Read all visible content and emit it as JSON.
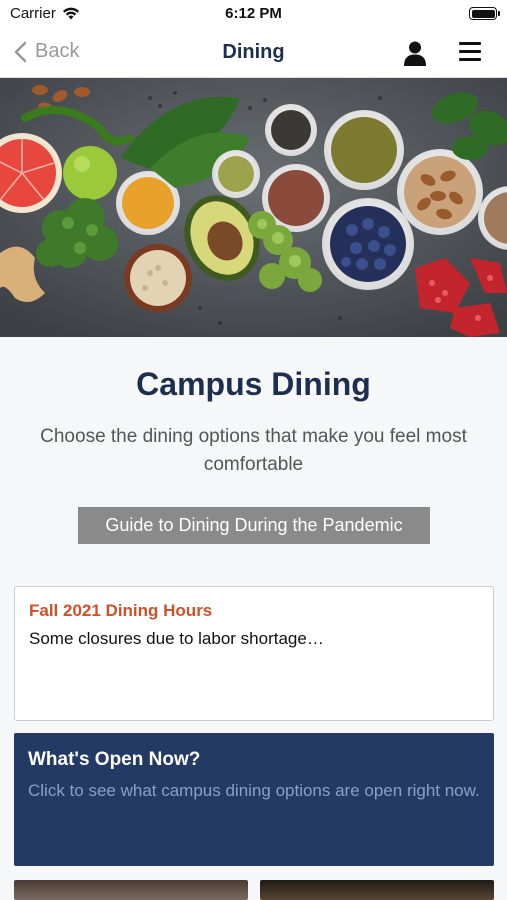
{
  "status_bar": {
    "carrier": "Carrier",
    "time": "6:12 PM"
  },
  "nav": {
    "back_label": "Back",
    "title": "Dining",
    "icons": [
      "chevron-left-icon",
      "user-icon",
      "menu-icon"
    ]
  },
  "hero": {
    "description_icon": "food-photo"
  },
  "intro": {
    "title": "Campus Dining",
    "subtitle": "Choose the dining options that make you feel most comfortable",
    "guide_button": "Guide to Dining During the Pandemic"
  },
  "hours_card": {
    "title": "Fall 2021 Dining Hours",
    "text": "Some closures due to labor shortage…"
  },
  "open_card": {
    "title": "What's Open Now?",
    "text": "Click to see what campus dining options are open right now."
  },
  "colors": {
    "navy": "#1d2e4f",
    "card_blue": "#233a64",
    "accent_orange": "#c9532a",
    "button_gray": "#8a8a8a"
  }
}
